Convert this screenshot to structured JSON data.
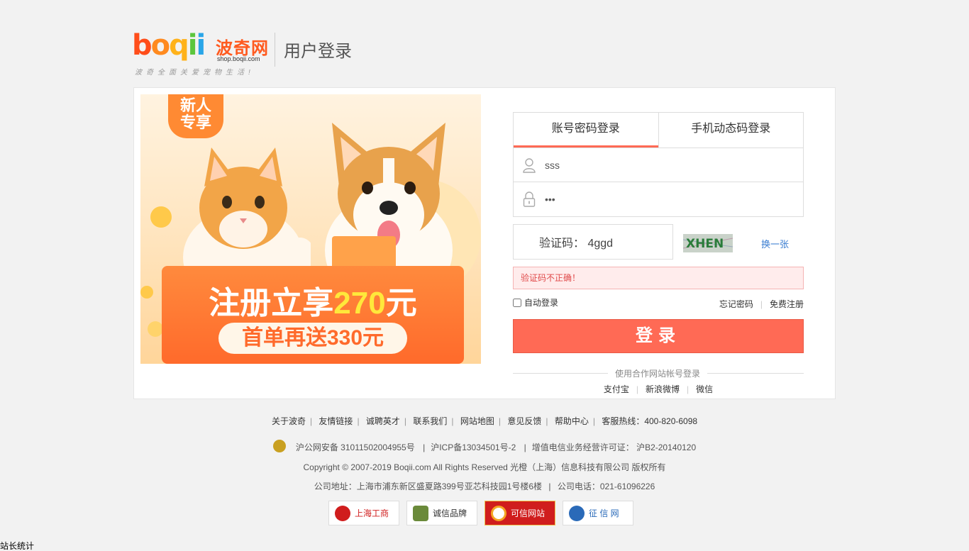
{
  "header": {
    "logo_letters": [
      {
        "ch": "b",
        "color": "#ff4d1a"
      },
      {
        "ch": "o",
        "color": "#ff8a1f"
      },
      {
        "ch": "q",
        "color": "#ffb21a"
      },
      {
        "ch": "i",
        "color": "#5cc63d"
      },
      {
        "ch": "i",
        "color": "#2aa6e8"
      }
    ],
    "logo_cn": "波奇网",
    "logo_domain": "shop.boqii.com",
    "slogan": "波奇全面关爱宠物生活!",
    "title": "用户登录"
  },
  "banner": {
    "tag_line1": "新人",
    "tag_line2": "专享",
    "promo_prefix": "注册立享",
    "promo_amount": "270",
    "promo_suffix": "元",
    "promo_sub": "首单再送330元",
    "colors": {
      "board": "#ff7a33",
      "highlight": "#ffe83b"
    }
  },
  "login": {
    "tabs": [
      {
        "label": "账号密码登录",
        "active": true
      },
      {
        "label": "手机动态码登录",
        "active": false
      }
    ],
    "username": {
      "value": "sss",
      "icon": "user-icon"
    },
    "password": {
      "value": "sss",
      "icon": "lock-icon"
    },
    "captcha": {
      "label": "验证码：",
      "value": "4ggd",
      "image_text": "XHEN",
      "refresh": "换一张"
    },
    "error": "验证码不正确！",
    "auto_login": "自动登录",
    "forgot": "忘记密码",
    "register": "免费注册",
    "submit": "登录",
    "partner_title": "使用合作网站帐号登录",
    "partners": [
      "支付宝",
      "新浪微博",
      "微信"
    ],
    "accent_color": "#ff6a55"
  },
  "footer": {
    "links": [
      "关于波奇",
      "友情链接",
      "诚聘英才",
      "联系我们",
      "网站地图",
      "意见反馈",
      "帮助中心"
    ],
    "hotline": "客服热线：400-820-6098",
    "police": "沪公网安备 31011502004955号",
    "icp": "沪ICP备13034501号-2",
    "license": "增值电信业务经营许可证： 沪B2-20140120",
    "copyright": "Copyright © 2007-2019 Boqii.com All Rights Reserved 光橙（上海）信息科技有限公司 版权所有",
    "address": "公司地址：上海市浦东新区盛夏路399号亚芯科技园1号楼6楼",
    "phone": "公司电话：021-61096226",
    "badges": [
      {
        "label": "上海工商",
        "icon": "shanghai-gongshang-icon",
        "color": "#d01d1d"
      },
      {
        "label": "诚信品牌",
        "icon": "shield-brand-icon",
        "color": "#6a8a3a"
      },
      {
        "label": "可信网站",
        "icon": "trusted-site-icon",
        "color": "#f5a623"
      },
      {
        "label": "征 信 网",
        "icon": "credit-globe-icon",
        "color": "#2a6ab8"
      }
    ],
    "stats": "站长统计"
  }
}
